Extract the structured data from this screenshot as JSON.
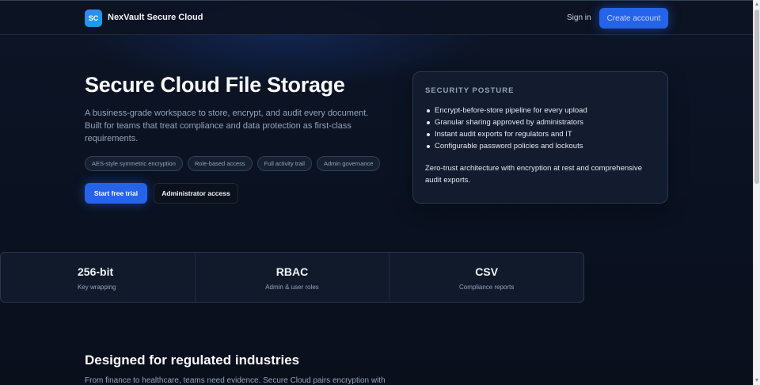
{
  "nav": {
    "logo_initials": "SC",
    "brand": "NexVault Secure Cloud",
    "sign_in": "Sign in",
    "create_account": "Create account"
  },
  "hero": {
    "title": "Secure Cloud File Storage",
    "description": "A business-grade workspace to store, encrypt, and audit every document. Built for teams that treat compliance and data protection as first-class requirements.",
    "tags": [
      "AES-style symmetric encryption",
      "Role-based access",
      "Full activity trail",
      "Admin governance"
    ],
    "primary_cta": "Start free trial",
    "secondary_cta": "Administrator access"
  },
  "security_card": {
    "title": "SECURITY POSTURE",
    "items": [
      "Encrypt-before-store pipeline for every upload",
      "Granular sharing approved by administrators",
      "Instant audit exports for regulators and IT",
      "Configurable password policies and lockouts"
    ],
    "summary": "Zero-trust architecture with encryption at rest and comprehensive audit exports."
  },
  "stats": [
    {
      "value": "256-bit",
      "label": "Key wrapping"
    },
    {
      "value": "RBAC",
      "label": "Admin & user roles"
    },
    {
      "value": "CSV",
      "label": "Compliance reports"
    }
  ],
  "section": {
    "title": "Designed for regulated industries",
    "description": "From finance to healthcare, teams need evidence. Secure Cloud pairs encryption with"
  },
  "colors": {
    "background": "#0b1220",
    "accent": "#2563eb",
    "card": "#131c2e"
  }
}
